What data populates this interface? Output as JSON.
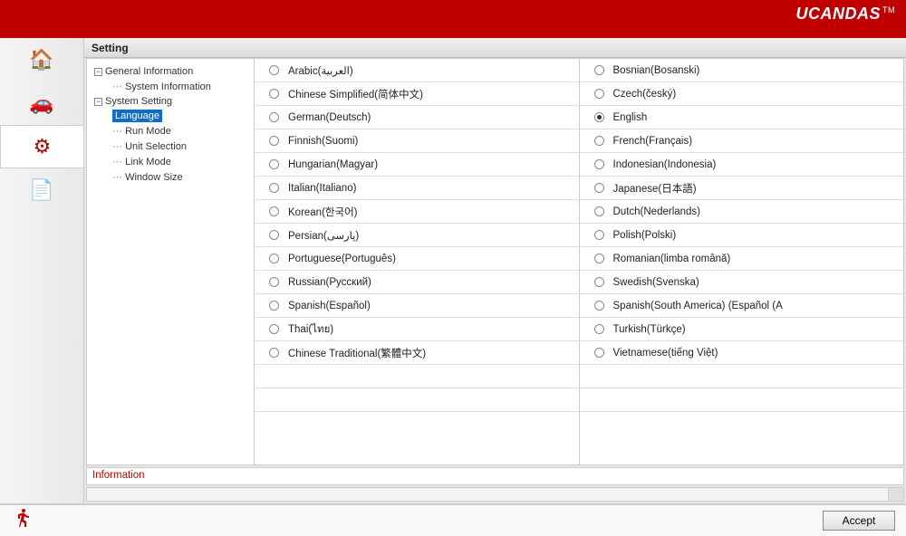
{
  "brand": {
    "name": "UCANDAS",
    "tm": "TM"
  },
  "panel": {
    "title": "Setting"
  },
  "tree": {
    "group1": "General Information",
    "group1_child1": "System Information",
    "group2": "System Setting",
    "g2_c1": "Language",
    "g2_c2": "Run Mode",
    "g2_c3": "Unit Selection",
    "g2_c4": "Link Mode",
    "g2_c5": "Window Size"
  },
  "languages_left": [
    "Arabic(العربية)",
    "Chinese Simplified(简体中文)",
    "German(Deutsch)",
    "Finnish(Suomi)",
    "Hungarian(Magyar)",
    "Italian(Italiano)",
    "Korean(한국어)",
    "Persian(پارسی)",
    "Portuguese(Português)",
    "Russian(Русский)",
    "Spanish(Español)",
    "Thai(ไทย)",
    "Chinese Traditional(繁體中文)"
  ],
  "languages_right": [
    "Bosnian(Bosanski)",
    "Czech(český)",
    "English",
    "French(Français)",
    "Indonesian(Indonesia)",
    "Japanese(日本語)",
    "Dutch(Nederlands)",
    "Polish(Polski)",
    "Romanian(limba română)",
    "Swedish(Svenska)",
    "Spanish(South America) (Español (A",
    "Turkish(Türkçe)",
    "Vietnamese(tiếng Việt)"
  ],
  "selected_language_index_right": 2,
  "info_label": "Information",
  "accept_label": "Accept"
}
